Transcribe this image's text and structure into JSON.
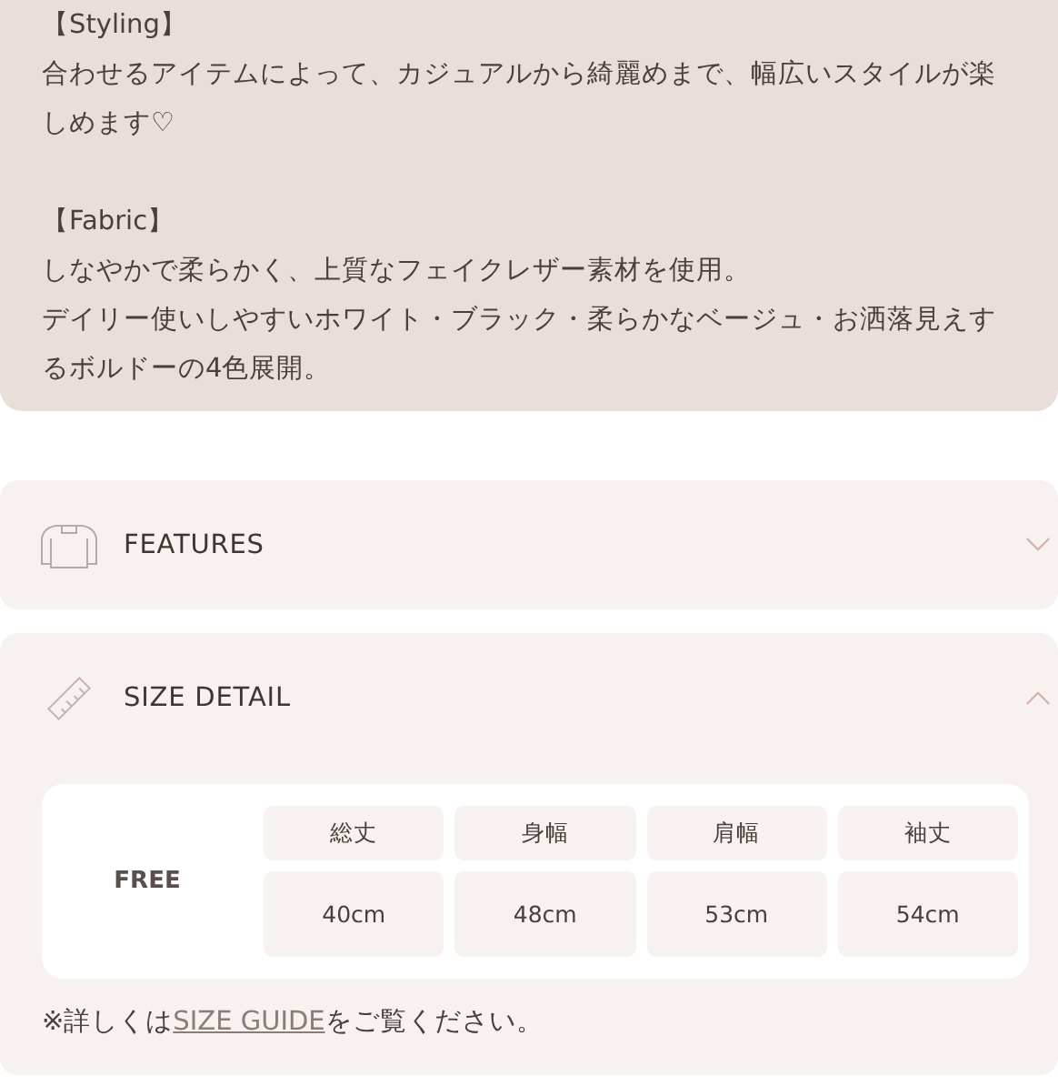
{
  "description": {
    "sections": [
      {
        "heading": "【Styling】",
        "lines": [
          "合わせるアイテムによって、カジュアルから綺麗めまで、幅広いスタイルが楽しめます♡"
        ]
      },
      {
        "heading": "【Fabric】",
        "lines": [
          "しなやかで柔らかく、上質なフェイクレザー素材を使用。",
          "デイリー使いしやすいホワイト・ブラック・柔らかなベージュ・お洒落見えするボルドーの4色展開。"
        ]
      }
    ]
  },
  "accordions": [
    {
      "kind": "features",
      "title": "FEATURES",
      "expanded": false
    },
    {
      "kind": "size",
      "title": "SIZE DETAIL",
      "expanded": true,
      "size_table": {
        "size": "FREE",
        "columns": [
          "総丈",
          "身幅",
          "肩幅",
          "袖丈"
        ],
        "values": [
          "40cm",
          "48cm",
          "53cm",
          "54cm"
        ]
      },
      "note": {
        "before": "※詳しくは",
        "link": "SIZE GUIDE",
        "after": "をご覧ください。"
      }
    }
  ]
}
